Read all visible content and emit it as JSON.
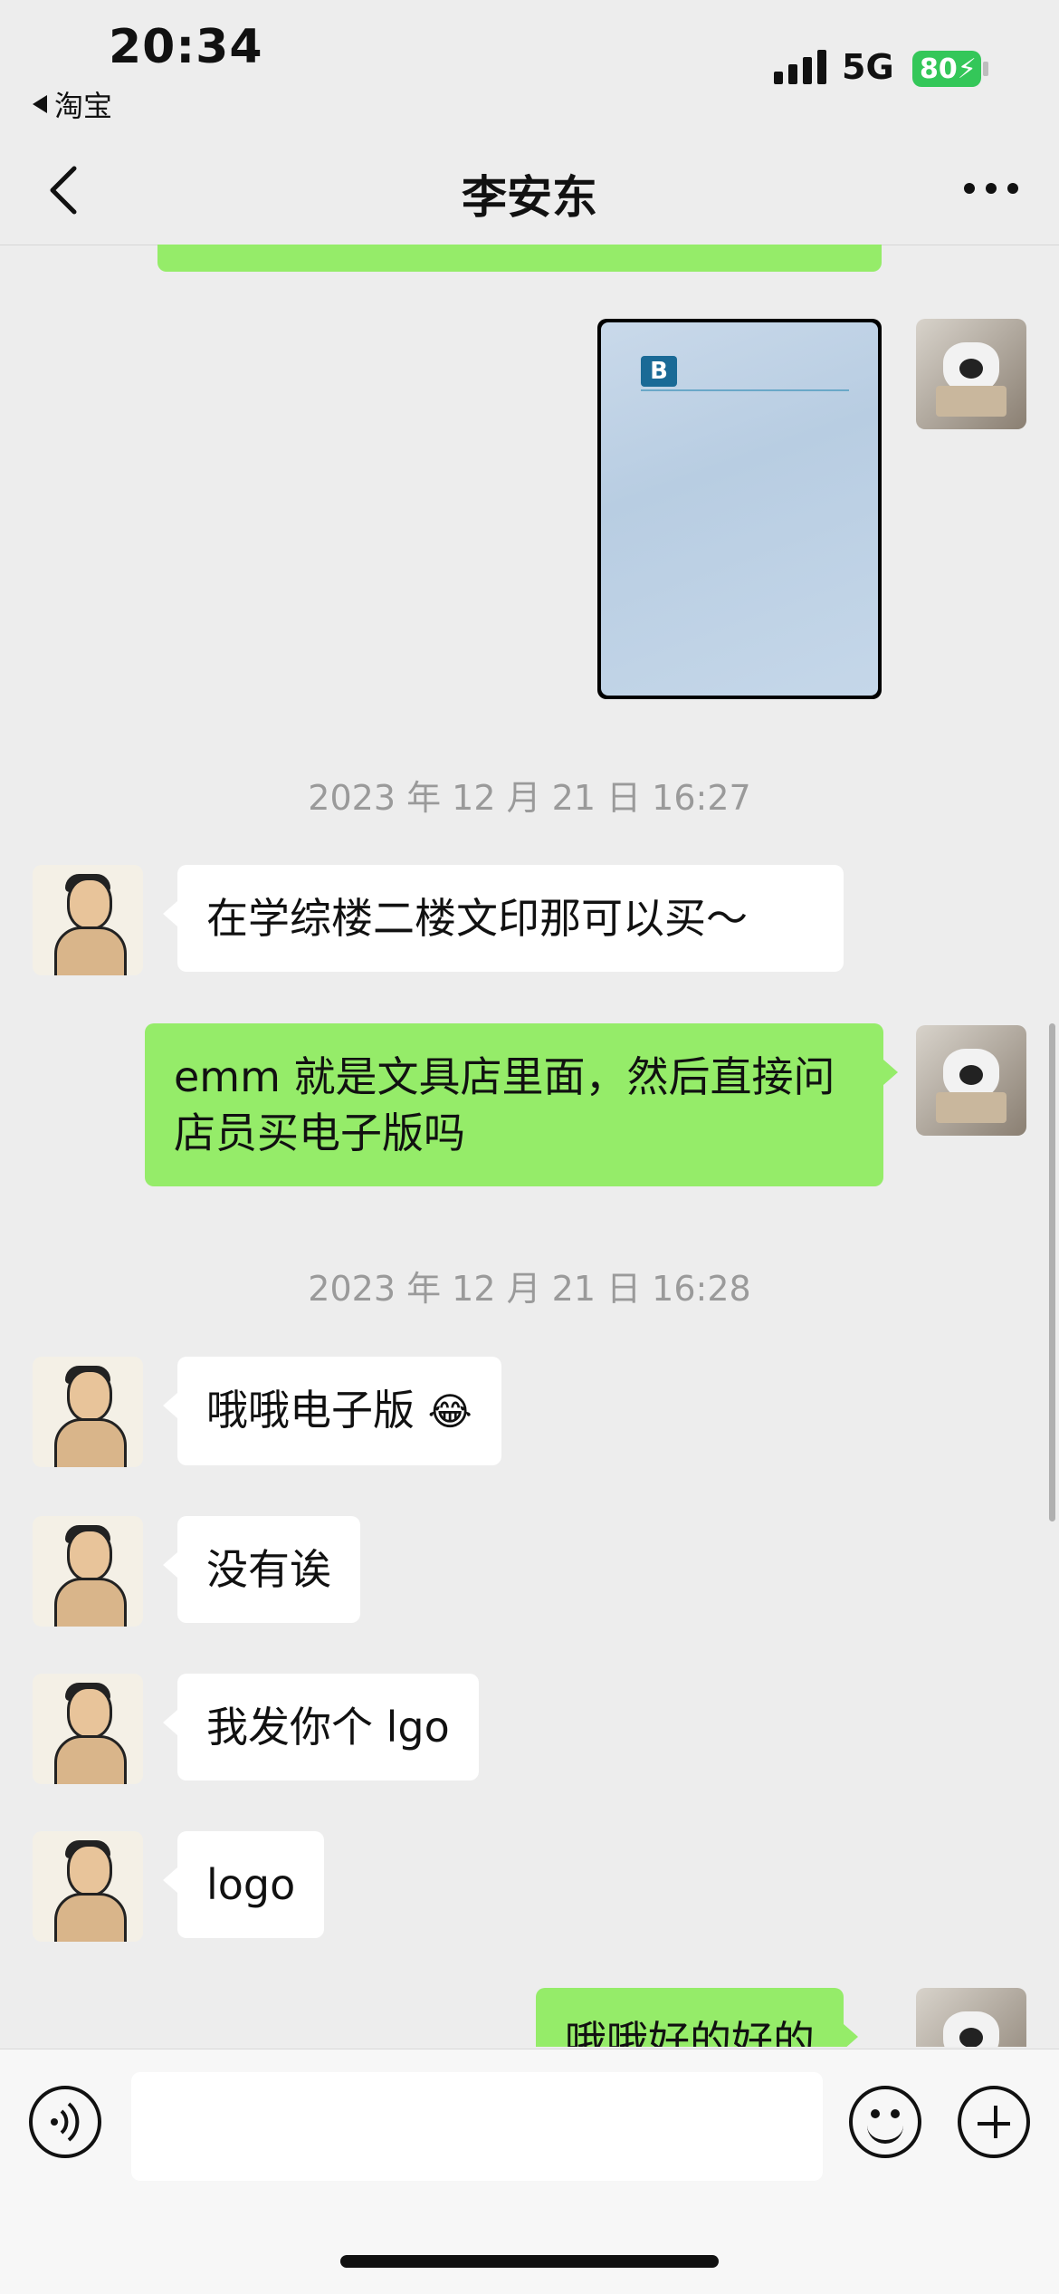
{
  "status_bar": {
    "time": "20:34",
    "back_app": "淘宝",
    "network": "5G",
    "battery": "80"
  },
  "nav": {
    "title": "李安东"
  },
  "messages": {
    "ts1": "2023 年 12 月 21 日 16:27",
    "m1": "在学综楼二楼文印那可以买～",
    "m2": "emm 就是文具店里面，然后直接问店员买电子版吗",
    "ts2": "2023 年 12 月 21 日 16:28",
    "m3": "哦哦电子版",
    "m4": "没有诶",
    "m5": "我发你个 lgo",
    "m6": "logo",
    "m7": "哦哦好的好的"
  },
  "icons": {
    "voice": "voice-icon",
    "emoji": "emoji-icon",
    "plus": "plus-icon",
    "back": "chevron-left-icon",
    "more": "more-icon"
  },
  "colors": {
    "background": "#EDEDED",
    "sent_bubble": "#95EC69",
    "received_bubble": "#FFFFFF",
    "battery": "#34C759"
  }
}
